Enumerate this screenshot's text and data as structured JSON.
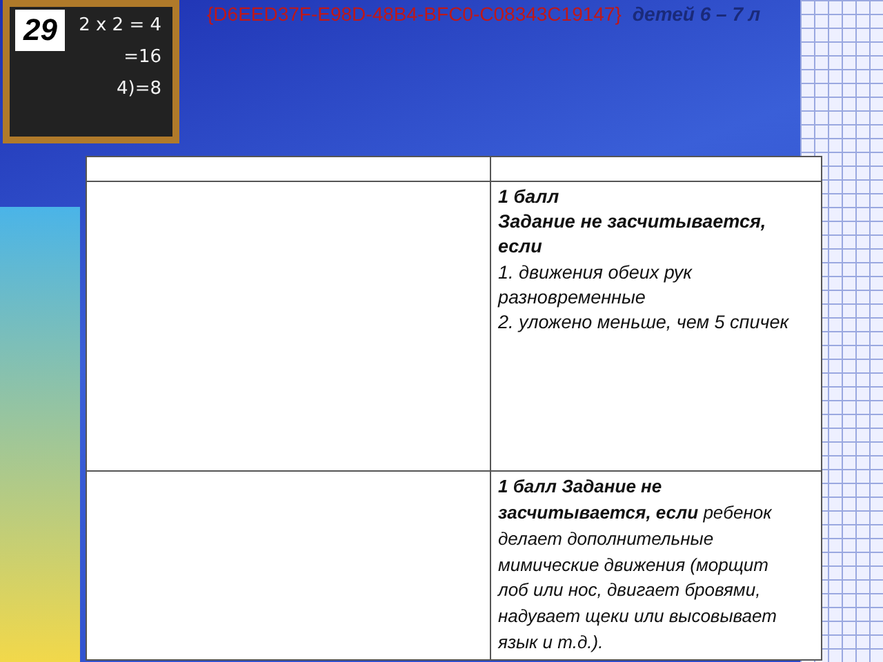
{
  "slide_number": "29",
  "header": {
    "code": "{D6EED37F-E98D-48B4-BFC0-C08343C19147}",
    "title_fragment": "детей 6 – 7 л"
  },
  "chalkboard": {
    "lines": [
      "2 x 2 = 4",
      "=16",
      "4)=8"
    ]
  },
  "table": {
    "rows": [
      {
        "cells": [
          "",
          ""
        ]
      },
      {
        "cells": [
          "",
          "**1 балл**\n**Задание не засчитывается, если**\n1. движения обеих рук разновременные\n2. уложено меньше, чем 5 спичек"
        ]
      },
      {
        "cells": [
          "",
          "**1 балл Задание не засчитывается, если** ребенок делает дополнительные мимические движения (морщит лоб или нос, двигает бровями, надувает щеки или высовывает язык и т.д.)."
        ]
      }
    ]
  }
}
